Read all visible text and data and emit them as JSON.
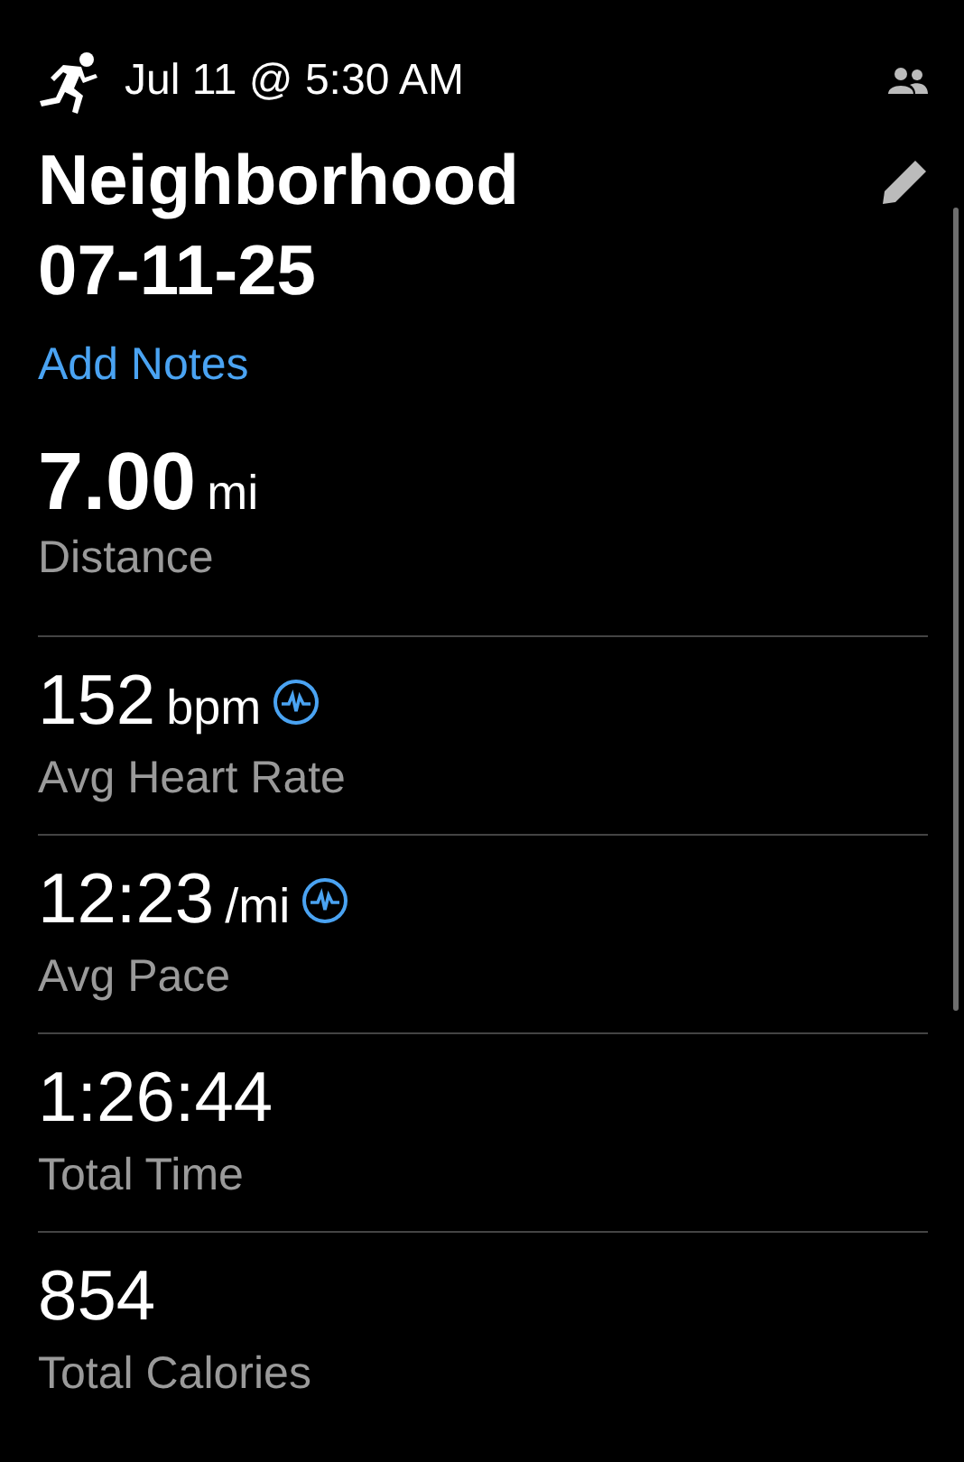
{
  "header": {
    "datetime": "Jul 11 @ 5:30 AM"
  },
  "title": "Neighborhood\n07-11-25",
  "add_notes": "Add Notes",
  "stats": [
    {
      "kind": "primary",
      "value": "7.00",
      "unit": "mi",
      "label": "Distance",
      "chart_link": false
    },
    {
      "kind": "standard",
      "value": "152",
      "unit": "bpm",
      "label": "Avg Heart Rate",
      "chart_link": true
    },
    {
      "kind": "standard",
      "value": "12:23",
      "unit": "/mi",
      "label": "Avg Pace",
      "chart_link": true
    },
    {
      "kind": "standard",
      "value": "1:26:44",
      "label": "Total Time",
      "chart_link": false
    },
    {
      "kind": "standard",
      "value": "854",
      "label": "Total Calories",
      "chart_link": false
    }
  ]
}
